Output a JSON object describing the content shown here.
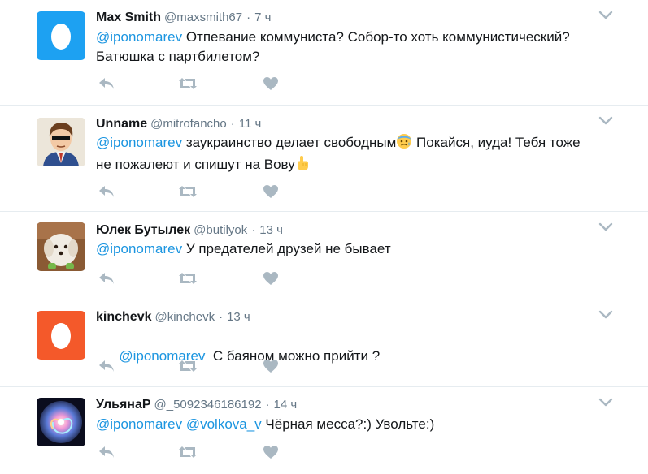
{
  "tweets": [
    {
      "name": "Max Smith",
      "handle": "@maxsmith67",
      "sep": "·",
      "time": "7 ч",
      "mention": "@iponomarev",
      "text_line1": " Отпевание коммуниста? Собор-то хоть коммунистический?",
      "text_line2": "Батюшка с партбилетом?",
      "avatar": "egg-avatar-blue"
    },
    {
      "name": "Unname",
      "handle": "@mitrofancho",
      "sep": "·",
      "time": "11 ч",
      "mention": "@iponomarev",
      "text_a": " заукраинство делает свободным",
      "emoji_a": "anxious-face-emoji",
      "text_b": " Покайся, иуда! Тебя тоже",
      "text_line2": "не пожалеют и спишут на Вову",
      "emoji_b": "pointing-up-emoji",
      "avatar": "cartoon-boy-avatar"
    },
    {
      "name": "Юлек Бутылек",
      "handle": "@butilyok",
      "sep": "·",
      "time": "13 ч",
      "mention": "@iponomarev",
      "text_line1": " У предателей друзей не бывает",
      "avatar": "dog-photo-avatar"
    },
    {
      "name": "kinchevk",
      "handle": "@kinchevk",
      "sep": "·",
      "time": "13 ч",
      "mention": "@iponomarev",
      "text_line1": "  С баяном можно прийти ?",
      "avatar": "egg-avatar-orange"
    },
    {
      "name": "УльянаР",
      "handle": "@_5092346186192",
      "sep": "·",
      "time": "14 ч",
      "mention": "@iponomarev",
      "mention2": "@volkova_v",
      "text_line1": " Чёрная месса?:) Увольте:)",
      "avatar": "swirl-avatar"
    }
  ],
  "icons": {
    "reply": "reply-icon",
    "retweet": "retweet-icon",
    "like": "heart-icon",
    "caret": "chevron-down-icon"
  },
  "colors": {
    "mention": "#1b95e0",
    "meta": "#657786",
    "icon": "#aab8c2",
    "divider": "#e6ecf0",
    "egg_blue": "#1da1f2",
    "egg_orange": "#f4592a"
  }
}
